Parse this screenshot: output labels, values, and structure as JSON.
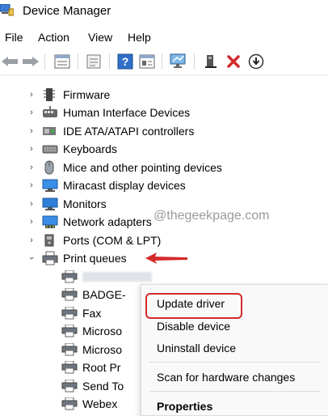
{
  "window": {
    "title": "Device Manager",
    "app_icon": "device-manager-icon"
  },
  "menubar": {
    "items": [
      "File",
      "Action",
      "View",
      "Help"
    ]
  },
  "toolbar": {
    "buttons": [
      "back-arrow-icon",
      "forward-arrow-icon",
      "properties-grid-icon",
      "show-hidden-icon",
      "help-icon",
      "action-list-icon",
      "monitor-scan-icon",
      "add-legacy-hardware-icon",
      "uninstall-x-icon",
      "update-download-icon"
    ],
    "accent_red": "#d42a2a"
  },
  "tree": {
    "categories": [
      {
        "label": "Firmware",
        "icon": "firmware-chip-icon",
        "expanded": false
      },
      {
        "label": "Human Interface Devices",
        "icon": "hid-icon",
        "expanded": false
      },
      {
        "label": "IDE ATA/ATAPI controllers",
        "icon": "ide-controller-icon",
        "expanded": false
      },
      {
        "label": "Keyboards",
        "icon": "keyboard-icon",
        "expanded": false
      },
      {
        "label": "Mice and other pointing devices",
        "icon": "mouse-icon",
        "expanded": false
      },
      {
        "label": "Miracast display devices",
        "icon": "display-icon",
        "expanded": false
      },
      {
        "label": "Monitors",
        "icon": "monitor-icon",
        "expanded": false
      },
      {
        "label": "Network adapters",
        "icon": "network-adapter-icon",
        "expanded": false
      },
      {
        "label": "Ports (COM & LPT)",
        "icon": "port-icon",
        "expanded": false
      },
      {
        "label": "Print queues",
        "icon": "printer-icon",
        "expanded": true
      }
    ],
    "print_queue_children": [
      "",
      "BADGE-",
      "Fax",
      "Microso",
      "Microso",
      "Root Pr",
      "Send To",
      "Webex"
    ]
  },
  "watermark": {
    "text": "@thegeekpage.com"
  },
  "context_menu": {
    "update_driver": "Update driver",
    "disable_device": "Disable device",
    "uninstall_device": "Uninstall device",
    "scan_hardware": "Scan for hardware changes",
    "properties": "Properties"
  }
}
